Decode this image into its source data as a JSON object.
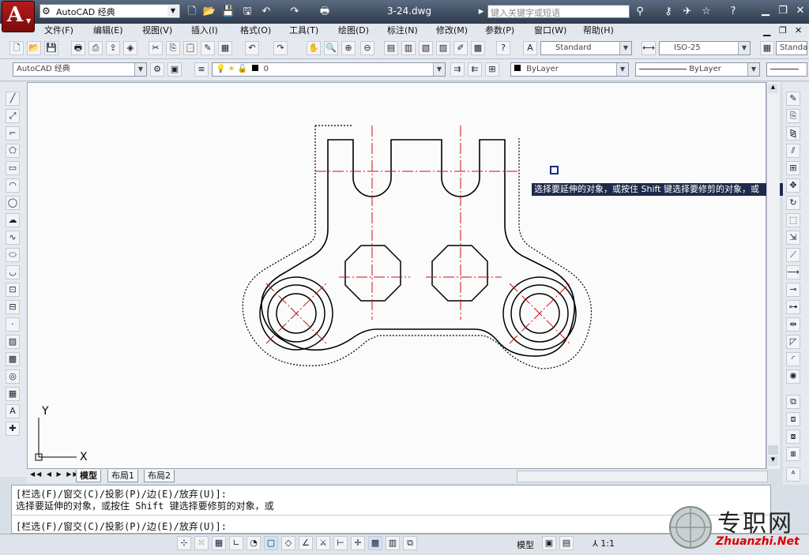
{
  "app": {
    "workspace": "AutoCAD 经典",
    "document_title": "3-24.dwg",
    "search_placeholder": "键入关键字或短语"
  },
  "menu": [
    "文件(F)",
    "编辑(E)",
    "视图(V)",
    "插入(I)",
    "格式(O)",
    "工具(T)",
    "绘图(D)",
    "标注(N)",
    "修改(M)",
    "参数(P)",
    "窗口(W)",
    "帮助(H)"
  ],
  "toolbar2": {
    "text_style": "Standard",
    "dim_style": "ISO-25",
    "table_style": "Standa"
  },
  "toolbar3": {
    "workspace": "AutoCAD 经典",
    "layer": "0",
    "color": "ByLayer",
    "linetype": "ByLayer"
  },
  "canvas": {
    "ucs_y": "Y",
    "ucs_x": "X",
    "tooltip": "选择要延伸的对象，或按住 Shift 键选择要修剪的对象，或"
  },
  "layout_tabs": [
    "模型",
    "布局1",
    "布局2"
  ],
  "command": {
    "line1": "[栏选(F)/窗交(C)/投影(P)/边(E)/放弃(U)]:",
    "line2": "选择要延伸的对象，或按住 Shift 键选择要修剪的对象，或",
    "line3": "[栏选(F)/窗交(C)/投影(P)/边(E)/放弃(U)]:"
  },
  "status": {
    "space": "模型",
    "scale": "1:1"
  },
  "watermark": {
    "cn": "专职网",
    "en": "Zhuanzhi.Net"
  },
  "colors": {
    "titlebar": "#3c4a5e",
    "canvas": "#fbfbfb",
    "centerline": "#cc1010",
    "outline": "#000000"
  }
}
